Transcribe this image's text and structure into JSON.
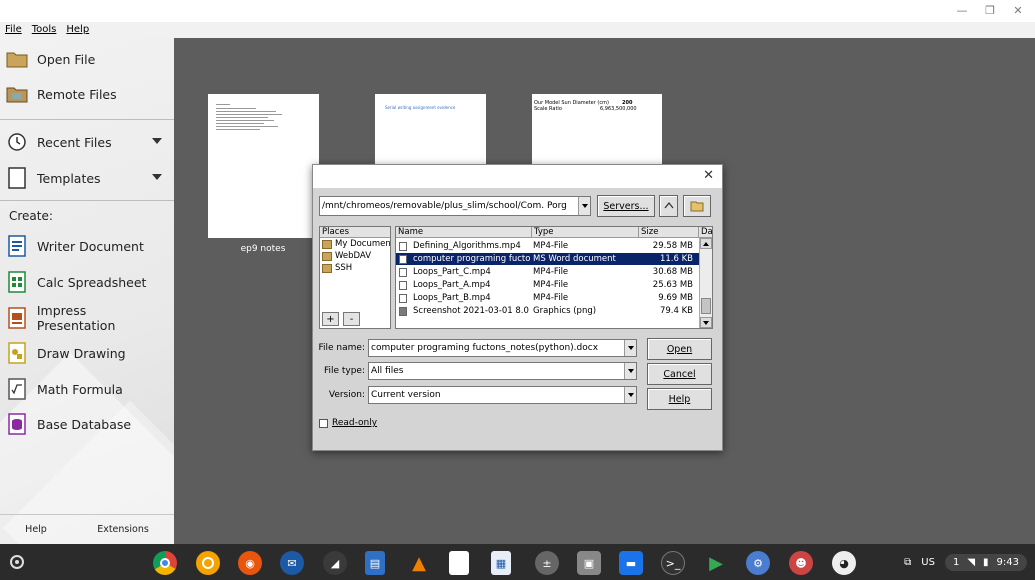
{
  "menubar": {
    "items": [
      "File",
      "Tools",
      "Help"
    ]
  },
  "sidebar": {
    "open_file": "Open File",
    "remote_files": "Remote Files",
    "recent_files": "Recent Files",
    "templates": "Templates",
    "create_label": "Create:",
    "create_items": [
      "Writer Document",
      "Calc Spreadsheet",
      "Impress Presentation",
      "Draw Drawing",
      "Math Formula",
      "Base Database"
    ],
    "help": "Help",
    "extensions": "Extensions"
  },
  "thumbnails": [
    {
      "title": "ep9 notes"
    },
    {
      "title": "",
      "blue_text": "Serial writing assignment evidence"
    },
    {
      "title": "",
      "line1_label": "Our Model Sun Diameter (cm)",
      "line1_value": "200",
      "line2_label": "Scale Ratio",
      "line2_value": "6,963,500,000"
    }
  ],
  "dialog": {
    "path": "/mnt/chromeos/removable/plus_slim/school/Com. Porg",
    "servers_button": "Servers...",
    "places_header": "Places",
    "places": [
      "My Documents",
      "WebDAV",
      "SSH"
    ],
    "columns": [
      "Name",
      "Type",
      "Size",
      "Da"
    ],
    "files": [
      {
        "name": "Defining_Algorithms.mp4",
        "type": "MP4-File",
        "size": "29.58 MB",
        "selected": false
      },
      {
        "name": "computer programing fuctons_notes(python).docx",
        "type": "MS Word document",
        "size": "11.6 KB",
        "selected": true
      },
      {
        "name": "Loops_Part_C.mp4",
        "type": "MP4-File",
        "size": "30.68 MB",
        "selected": false
      },
      {
        "name": "Loops_Part_A.mp4",
        "type": "MP4-File",
        "size": "25.63 MB",
        "selected": false
      },
      {
        "name": "Loops_Part_B.mp4",
        "type": "MP4-File",
        "size": "9.69 MB",
        "selected": false
      },
      {
        "name": "Screenshot 2021-03-01 8.0",
        "type": "Graphics (png)",
        "size": "79.4 KB",
        "selected": false
      }
    ],
    "file_name_label": "File name:",
    "file_name_value": "computer programing fuctons_notes(python).docx",
    "file_type_label": "File type:",
    "file_type_value": "All files",
    "version_label": "Version:",
    "version_value": "Current version",
    "open_button": "Open",
    "cancel_button": "Cancel",
    "help_button": "Help",
    "read_only_label": "Read-only"
  },
  "tray": {
    "keyboard": "US",
    "notifications": "1",
    "time": "9:43"
  }
}
